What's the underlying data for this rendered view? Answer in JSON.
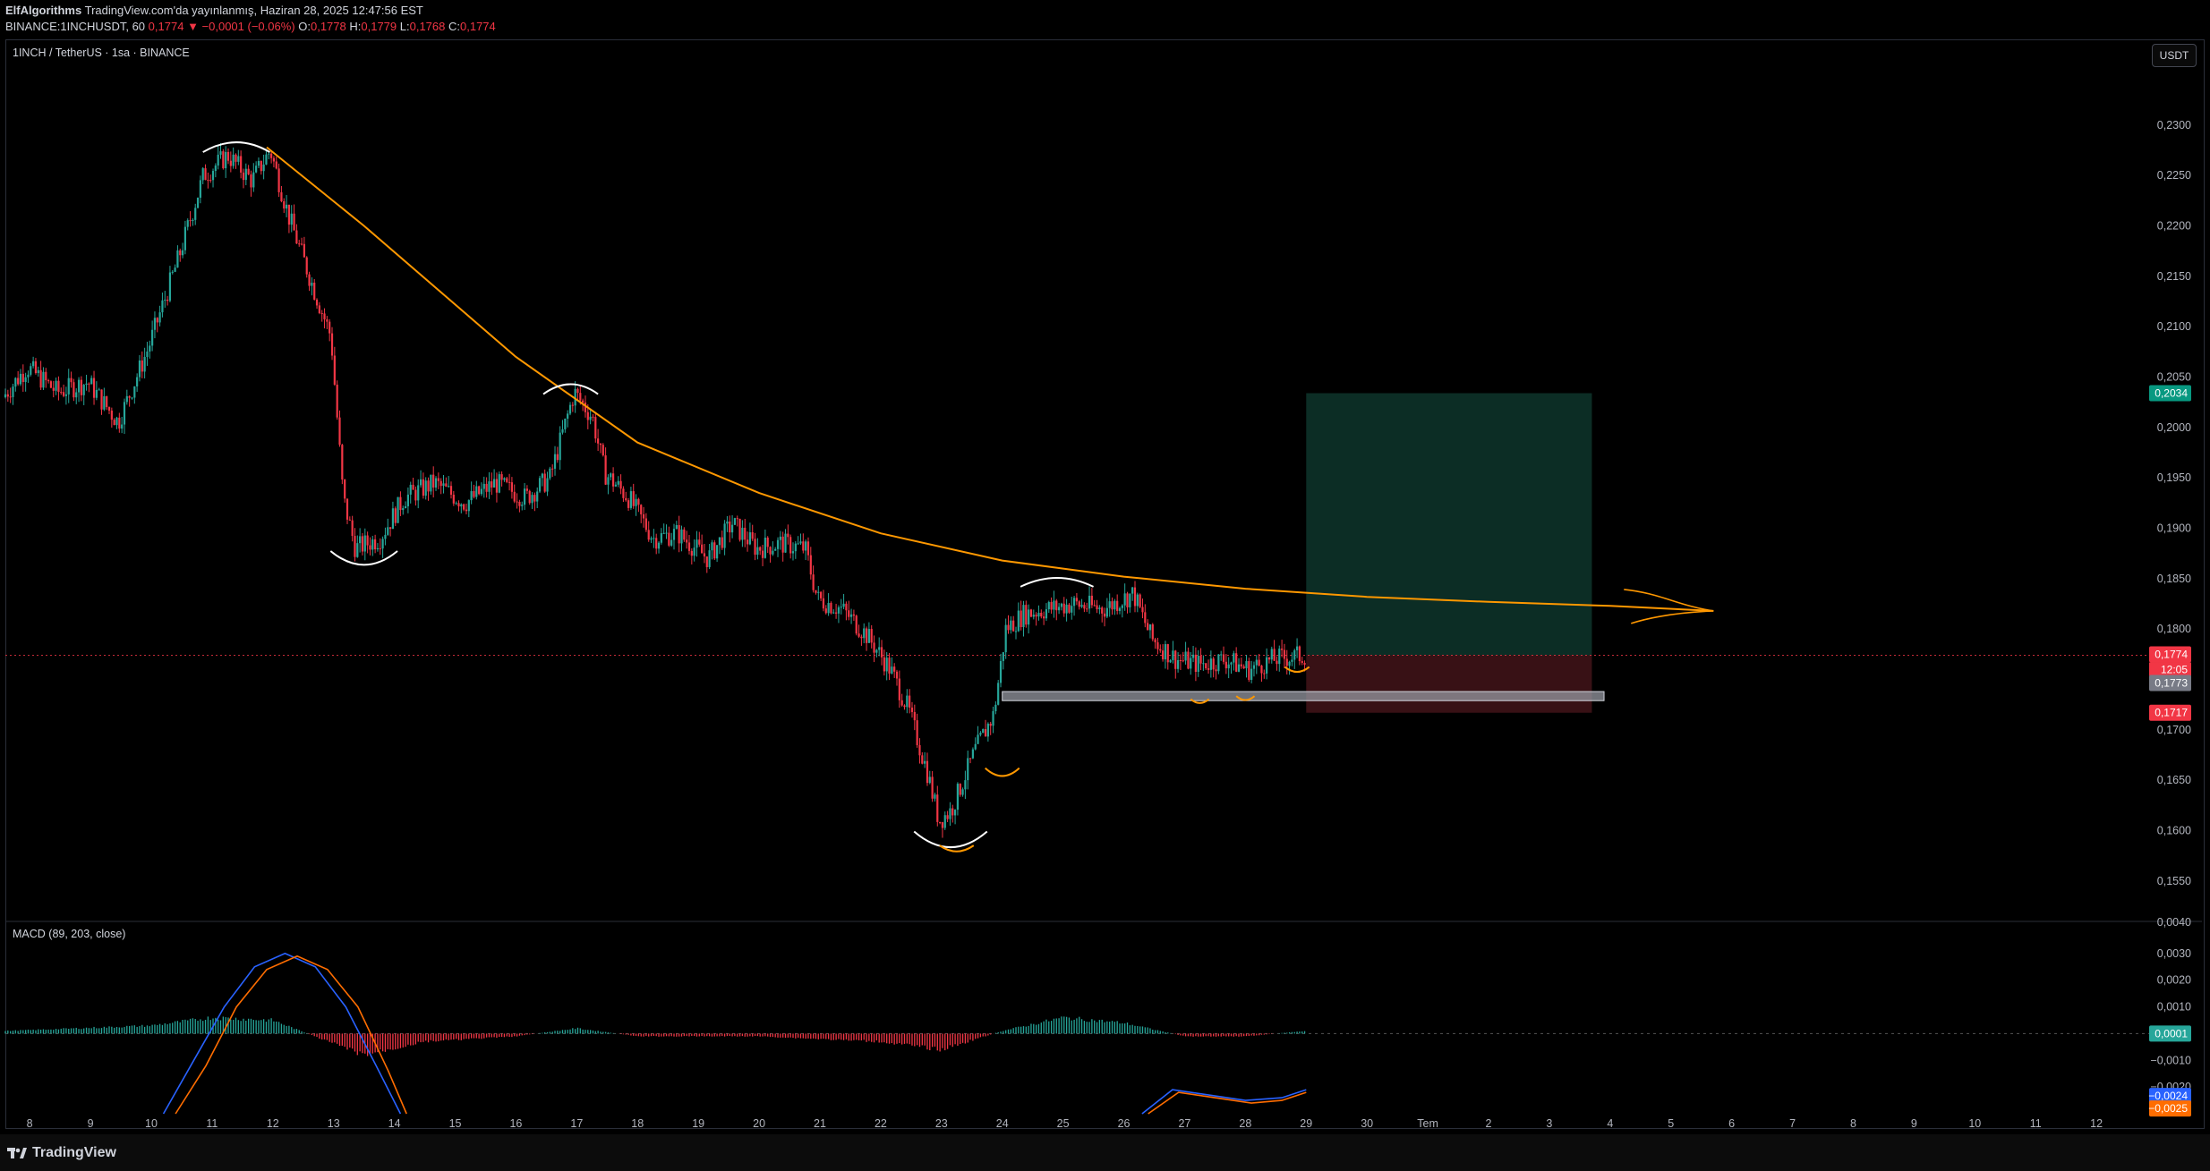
{
  "header": {
    "author": "ElfAlgorithms",
    "published": "TradingView.com'da yayınlanmış, Haziran 28, 2025 12:47:56 EST",
    "symbol_line": "BINANCE:1INCHUSDT, 60",
    "last": "0,1774",
    "change": "▼ −0,0001 (−0.06%)",
    "o_label": "O:",
    "o": "0,1778",
    "h_label": "H:",
    "h": "0,1779",
    "l_label": "L:",
    "l": "0,1768",
    "c_label": "C:",
    "c": "0,1774"
  },
  "pane_title": "1INCH / TetherUS · 1sa · BINANCE",
  "currency_button": "USDT",
  "macd_title": "MACD (89, 203, close)",
  "brand": "TradingView",
  "colors": {
    "up": "#26a69a",
    "down": "#f23645",
    "trendline": "#ff9800",
    "arcs_white": "#ffffff",
    "arcs_orange": "#ff9800",
    "macd_line": "#2962ff",
    "signal_line": "#ff6d00",
    "target_zone": "#0d2f27",
    "stop_zone": "#3b1216",
    "support_zone": "#9598a1"
  },
  "icons": [
    "tradingview-logo-icon"
  ],
  "chart_data": {
    "type": "candlestick",
    "y_axis": {
      "ticks": [
        "0,2300",
        "0,2250",
        "0,2200",
        "0,2150",
        "0,2100",
        "0,2050",
        "0,2000",
        "0,1950",
        "0,1900",
        "0,1850",
        "0,1800",
        "0,1750",
        "0,1700",
        "0,1650",
        "0,1600",
        "0,1550"
      ],
      "tick_values": [
        0.23,
        0.225,
        0.22,
        0.215,
        0.21,
        0.205,
        0.2,
        0.195,
        0.19,
        0.185,
        0.18,
        0.175,
        0.17,
        0.165,
        0.16,
        0.155
      ],
      "range": [
        0.151,
        0.2385
      ]
    },
    "x_axis": {
      "labels": [
        "8",
        "9",
        "10",
        "11",
        "12",
        "13",
        "14",
        "15",
        "16",
        "17",
        "18",
        "19",
        "20",
        "21",
        "22",
        "23",
        "24",
        "25",
        "26",
        "27",
        "28",
        "29",
        "30",
        "Tem",
        "2",
        "3",
        "4",
        "5",
        "6",
        "7",
        "8",
        "9",
        "10",
        "11",
        "12"
      ],
      "label_days": [
        8,
        9,
        10,
        11,
        12,
        13,
        14,
        15,
        16,
        17,
        18,
        19,
        20,
        21,
        22,
        23,
        24,
        25,
        26,
        27,
        28,
        29,
        30,
        31,
        32,
        33,
        34,
        35,
        36,
        37,
        38,
        39,
        40,
        41,
        42
      ],
      "day_range": [
        7.6,
        43.0
      ]
    },
    "price_path": [
      [
        7.6,
        0.203
      ],
      [
        8.0,
        0.206
      ],
      [
        8.5,
        0.2035
      ],
      [
        9.0,
        0.2045
      ],
      [
        9.5,
        0.2005
      ],
      [
        10.0,
        0.208
      ],
      [
        10.5,
        0.217
      ],
      [
        10.9,
        0.225
      ],
      [
        11.3,
        0.227
      ],
      [
        11.7,
        0.2245
      ],
      [
        12.0,
        0.2275
      ],
      [
        12.3,
        0.221
      ],
      [
        12.7,
        0.214
      ],
      [
        13.0,
        0.209
      ],
      [
        13.2,
        0.193
      ],
      [
        13.4,
        0.188
      ],
      [
        13.8,
        0.189
      ],
      [
        14.2,
        0.193
      ],
      [
        14.7,
        0.1945
      ],
      [
        15.2,
        0.1925
      ],
      [
        15.7,
        0.1945
      ],
      [
        16.2,
        0.193
      ],
      [
        16.6,
        0.195
      ],
      [
        17.0,
        0.2035
      ],
      [
        17.3,
        0.201
      ],
      [
        17.5,
        0.1955
      ],
      [
        17.9,
        0.193
      ],
      [
        18.3,
        0.189
      ],
      [
        18.7,
        0.1895
      ],
      [
        19.2,
        0.187
      ],
      [
        19.6,
        0.1905
      ],
      [
        20.0,
        0.188
      ],
      [
        20.4,
        0.1885
      ],
      [
        20.8,
        0.188
      ],
      [
        21.0,
        0.183
      ],
      [
        21.4,
        0.182
      ],
      [
        21.8,
        0.1795
      ],
      [
        22.2,
        0.176
      ],
      [
        22.5,
        0.172
      ],
      [
        22.8,
        0.166
      ],
      [
        23.0,
        0.161
      ],
      [
        23.2,
        0.162
      ],
      [
        23.6,
        0.168
      ],
      [
        23.9,
        0.1715
      ],
      [
        24.1,
        0.18
      ],
      [
        24.4,
        0.1815
      ],
      [
        24.8,
        0.182
      ],
      [
        25.2,
        0.1825
      ],
      [
        25.7,
        0.182
      ],
      [
        26.2,
        0.1835
      ],
      [
        26.5,
        0.179
      ],
      [
        26.9,
        0.177
      ],
      [
        27.3,
        0.1765
      ],
      [
        27.7,
        0.177
      ],
      [
        28.1,
        0.176
      ],
      [
        28.5,
        0.177
      ],
      [
        29.0,
        0.1774
      ]
    ],
    "last_price": 0.1774,
    "last_price_label": "0,1774",
    "countdown_label": "12:05",
    "bid_label": "0,1773",
    "target_label": "0,2034",
    "target_value": 0.2034,
    "stop_label": "0,1717",
    "stop_value": 0.1717,
    "position": {
      "entry": 0.1774,
      "target": 0.2034,
      "stop": 0.1717,
      "start_day": 29.0,
      "end_day": 33.7
    },
    "support_zone": {
      "from": 0.1729,
      "to": 0.1738,
      "start_day": 24.0,
      "end_day": 33.9
    },
    "trendline": [
      [
        11.9,
        0.2278
      ],
      [
        13.5,
        0.22
      ],
      [
        16.0,
        0.207
      ],
      [
        18.0,
        0.1985
      ],
      [
        20.0,
        0.1935
      ],
      [
        22.0,
        0.1895
      ],
      [
        24.0,
        0.1868
      ],
      [
        26.0,
        0.1852
      ],
      [
        28.0,
        0.184
      ],
      [
        30.0,
        0.1832
      ],
      [
        32.0,
        0.1827
      ],
      [
        34.0,
        0.1823
      ],
      [
        35.7,
        0.1818
      ]
    ],
    "pattern_arcs_white": [
      {
        "day": 11.4,
        "price": 0.2282,
        "rx": 0.55,
        "ry": 10,
        "dir": "top"
      },
      {
        "day": 13.5,
        "price": 0.1865,
        "rx": 0.55,
        "ry": 14,
        "dir": "bottom"
      },
      {
        "day": 16.9,
        "price": 0.2042,
        "rx": 0.45,
        "ry": 10,
        "dir": "top"
      },
      {
        "day": 23.15,
        "price": 0.1585,
        "rx": 0.6,
        "ry": 16,
        "dir": "bottom"
      },
      {
        "day": 24.9,
        "price": 0.185,
        "rx": 0.6,
        "ry": 9,
        "dir": "top"
      }
    ],
    "pattern_arcs_orange": [
      {
        "day": 23.25,
        "price": 0.158,
        "rx": 0.28,
        "ry": 6,
        "dir": "bottom"
      },
      {
        "day": 24.0,
        "price": 0.1655,
        "rx": 0.28,
        "ry": 8,
        "dir": "bottom"
      },
      {
        "day": 27.25,
        "price": 0.1727,
        "rx": 0.15,
        "ry": 4,
        "dir": "bottom"
      },
      {
        "day": 28.0,
        "price": 0.173,
        "rx": 0.15,
        "ry": 4,
        "dir": "bottom"
      },
      {
        "day": 28.85,
        "price": 0.1758,
        "rx": 0.2,
        "ry": 5,
        "dir": "bottom"
      }
    ],
    "macd": {
      "y_ticks": [
        "0,0030",
        "0,0020",
        "0,0010",
        "−0,0010",
        "−0,0020"
      ],
      "y_tick_values": [
        0.003,
        0.002,
        0.001,
        -0.001,
        -0.002
      ],
      "range": [
        -0.003,
        0.0042
      ],
      "top_partial_label": "0,0040",
      "histogram_label": "0,0001",
      "macd_label": "−0,0024",
      "signal_label": "−0,0025",
      "macd_line": [
        [
          10.2,
          -0.003
        ],
        [
          10.7,
          -0.001
        ],
        [
          11.2,
          0.001
        ],
        [
          11.7,
          0.0025
        ],
        [
          12.2,
          0.003
        ],
        [
          12.7,
          0.0025
        ],
        [
          13.2,
          0.001
        ],
        [
          13.7,
          -0.0012
        ],
        [
          14.1,
          -0.003
        ]
      ],
      "signal_line": [
        [
          10.4,
          -0.003
        ],
        [
          10.9,
          -0.0012
        ],
        [
          11.4,
          0.001
        ],
        [
          11.9,
          0.0024
        ],
        [
          12.4,
          0.0029
        ],
        [
          12.9,
          0.0024
        ],
        [
          13.4,
          0.001
        ],
        [
          13.9,
          -0.0014
        ],
        [
          14.2,
          -0.003
        ]
      ],
      "macd_tail": [
        [
          26.3,
          -0.003
        ],
        [
          26.8,
          -0.0021
        ],
        [
          27.4,
          -0.0023
        ],
        [
          28.0,
          -0.0025
        ],
        [
          28.6,
          -0.0024
        ],
        [
          29.0,
          -0.0021
        ]
      ],
      "signal_tail": [
        [
          26.4,
          -0.003
        ],
        [
          26.9,
          -0.0022
        ],
        [
          27.5,
          -0.0024
        ],
        [
          28.1,
          -0.0026
        ],
        [
          28.6,
          -0.0025
        ],
        [
          29.0,
          -0.0022
        ]
      ],
      "histogram_profile": [
        [
          7.6,
          0.0001
        ],
        [
          10.0,
          0.0003
        ],
        [
          11.0,
          0.0006
        ],
        [
          12.0,
          0.0005
        ],
        [
          12.8,
          -0.0002
        ],
        [
          13.5,
          -0.0008
        ],
        [
          14.5,
          -0.0003
        ],
        [
          16.0,
          -0.0001
        ],
        [
          17.0,
          0.0002
        ],
        [
          18.0,
          -0.0001
        ],
        [
          20.0,
          -0.0001
        ],
        [
          22.0,
          -0.0003
        ],
        [
          23.0,
          -0.0006
        ],
        [
          24.0,
          0.0001
        ],
        [
          25.0,
          0.0006
        ],
        [
          26.0,
          0.0004
        ],
        [
          27.0,
          -0.0001
        ],
        [
          28.0,
          -0.0001
        ],
        [
          29.0,
          0.0001
        ]
      ]
    }
  }
}
